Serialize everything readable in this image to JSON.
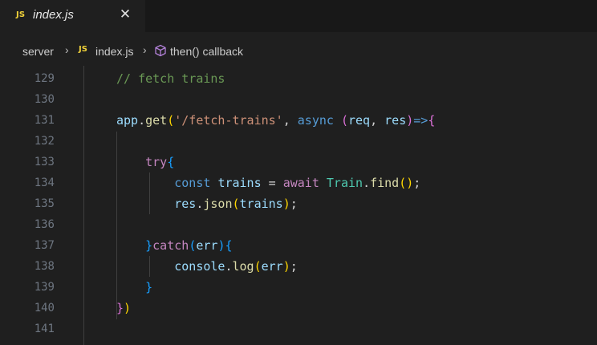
{
  "tab": {
    "icon_text": "JS",
    "filename": "index.js",
    "close_glyph": "✕"
  },
  "breadcrumb": {
    "folder": "server",
    "separator": "›",
    "file_icon_text": "JS",
    "file": "index.js",
    "symbol": "then() callback"
  },
  "colors": {
    "comment": "#6a9955",
    "variable": "#9cdcfe",
    "function": "#dcdcaa",
    "string": "#ce9178",
    "keyword": "#569cd6",
    "control": "#c586c0",
    "class": "#4ec9b0",
    "bracket_level_1": "#ffd700",
    "bracket_level_2": "#da70d6",
    "bracket_level_3": "#179fff",
    "js_icon": "#f1d23a"
  },
  "editor": {
    "lines": [
      {
        "number": "129",
        "tokens": [
          {
            "t": "// fetch trains",
            "k": "comment"
          }
        ]
      },
      {
        "number": "130",
        "tokens": []
      },
      {
        "number": "131",
        "tokens": [
          {
            "t": "app",
            "k": "var"
          },
          {
            "t": ".",
            "k": "p"
          },
          {
            "t": "get",
            "k": "fn"
          },
          {
            "t": "(",
            "k": "b1"
          },
          {
            "t": "'/fetch-trains'",
            "k": "str"
          },
          {
            "t": ", ",
            "k": "p"
          },
          {
            "t": "async",
            "k": "kw"
          },
          {
            "t": " ",
            "k": "p"
          },
          {
            "t": "(",
            "k": "b2"
          },
          {
            "t": "req",
            "k": "var"
          },
          {
            "t": ", ",
            "k": "p"
          },
          {
            "t": "res",
            "k": "var"
          },
          {
            "t": ")",
            "k": "b2"
          },
          {
            "t": "=>",
            "k": "kw"
          },
          {
            "t": "{",
            "k": "b2"
          }
        ]
      },
      {
        "number": "132",
        "tokens": []
      },
      {
        "number": "133",
        "tokens": [
          {
            "t": "    ",
            "k": "p"
          },
          {
            "t": "try",
            "k": "ctl"
          },
          {
            "t": "{",
            "k": "b3"
          }
        ]
      },
      {
        "number": "134",
        "tokens": [
          {
            "t": "        ",
            "k": "p"
          },
          {
            "t": "const",
            "k": "kw"
          },
          {
            "t": " ",
            "k": "p"
          },
          {
            "t": "trains",
            "k": "var"
          },
          {
            "t": " = ",
            "k": "p"
          },
          {
            "t": "await",
            "k": "ctl"
          },
          {
            "t": " ",
            "k": "p"
          },
          {
            "t": "Train",
            "k": "cls"
          },
          {
            "t": ".",
            "k": "p"
          },
          {
            "t": "find",
            "k": "fn"
          },
          {
            "t": "()",
            "k": "b1"
          },
          {
            "t": ";",
            "k": "p"
          }
        ]
      },
      {
        "number": "135",
        "tokens": [
          {
            "t": "        ",
            "k": "p"
          },
          {
            "t": "res",
            "k": "var"
          },
          {
            "t": ".",
            "k": "p"
          },
          {
            "t": "json",
            "k": "fn"
          },
          {
            "t": "(",
            "k": "b1"
          },
          {
            "t": "trains",
            "k": "var"
          },
          {
            "t": ")",
            "k": "b1"
          },
          {
            "t": ";",
            "k": "p"
          }
        ]
      },
      {
        "number": "136",
        "tokens": []
      },
      {
        "number": "137",
        "tokens": [
          {
            "t": "    ",
            "k": "p"
          },
          {
            "t": "}",
            "k": "b3"
          },
          {
            "t": "catch",
            "k": "ctl"
          },
          {
            "t": "(",
            "k": "b3"
          },
          {
            "t": "err",
            "k": "var"
          },
          {
            "t": ")",
            "k": "b3"
          },
          {
            "t": "{",
            "k": "b3"
          }
        ]
      },
      {
        "number": "138",
        "tokens": [
          {
            "t": "        ",
            "k": "p"
          },
          {
            "t": "console",
            "k": "var"
          },
          {
            "t": ".",
            "k": "p"
          },
          {
            "t": "log",
            "k": "fn"
          },
          {
            "t": "(",
            "k": "b1"
          },
          {
            "t": "err",
            "k": "var"
          },
          {
            "t": ")",
            "k": "b1"
          },
          {
            "t": ";",
            "k": "p"
          }
        ]
      },
      {
        "number": "139",
        "tokens": [
          {
            "t": "    ",
            "k": "p"
          },
          {
            "t": "}",
            "k": "b3"
          }
        ]
      },
      {
        "number": "140",
        "tokens": [
          {
            "t": "}",
            "k": "b2"
          },
          {
            "t": ")",
            "k": "b1"
          }
        ]
      },
      {
        "number": "141",
        "tokens": []
      }
    ]
  }
}
